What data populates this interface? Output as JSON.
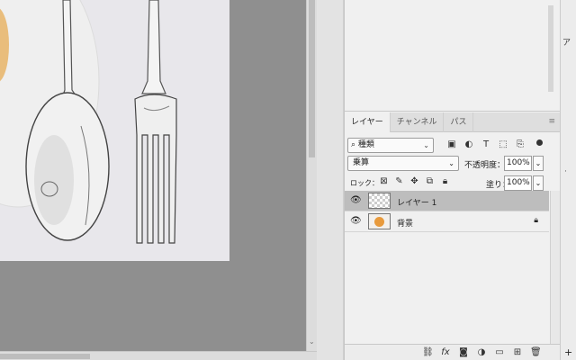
{
  "layers_panel": {
    "tabs": [
      {
        "label": "レイヤー"
      },
      {
        "label": "チャンネル"
      },
      {
        "label": "パス"
      }
    ],
    "menu_icon": "panel-menu-icon",
    "filter": {
      "kind_label": "種類",
      "search_icon": "search-icon"
    },
    "blend_mode": "乗算",
    "opacity_label": "不透明度：",
    "opacity_value": "100%",
    "lock_label": "ロック：",
    "fill_label": "塗り：",
    "fill_value": "100%",
    "layers": [
      {
        "name": "レイヤー 1",
        "selected": true,
        "locked": false
      },
      {
        "name": "背景",
        "selected": false,
        "locked": true
      }
    ]
  },
  "right_strip": {
    "glyph": "ア"
  }
}
